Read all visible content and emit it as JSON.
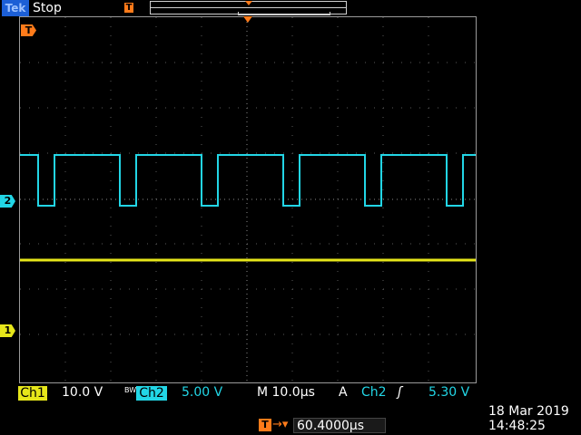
{
  "header": {
    "logo": "Tek",
    "run_state": "Stop",
    "trigger_marker": "T"
  },
  "screen": {
    "trigger_level_marker": "T",
    "ch2_marker": "2",
    "ch1_marker": "1"
  },
  "readouts": {
    "ch1_label": "Ch1",
    "ch1_scale": "10.0 V",
    "bw_limit_icon": "BW",
    "ch2_label": "Ch2",
    "ch2_scale": "5.00 V",
    "time_scale": "M 10.0µs",
    "trigger_mode": "A",
    "trigger_source": "Ch2",
    "trigger_slope_icon": "rising-edge-icon",
    "trigger_level": "5.30 V",
    "trigger_position_icon": "T",
    "trigger_position": "60.4000µs",
    "date": "18 Mar  2019",
    "time": "14:48:25"
  },
  "colors": {
    "ch1": "#e6e61a",
    "ch2": "#22d6e6",
    "trigger": "#ff7b1a",
    "logo_bg": "#1c5fd6"
  }
}
